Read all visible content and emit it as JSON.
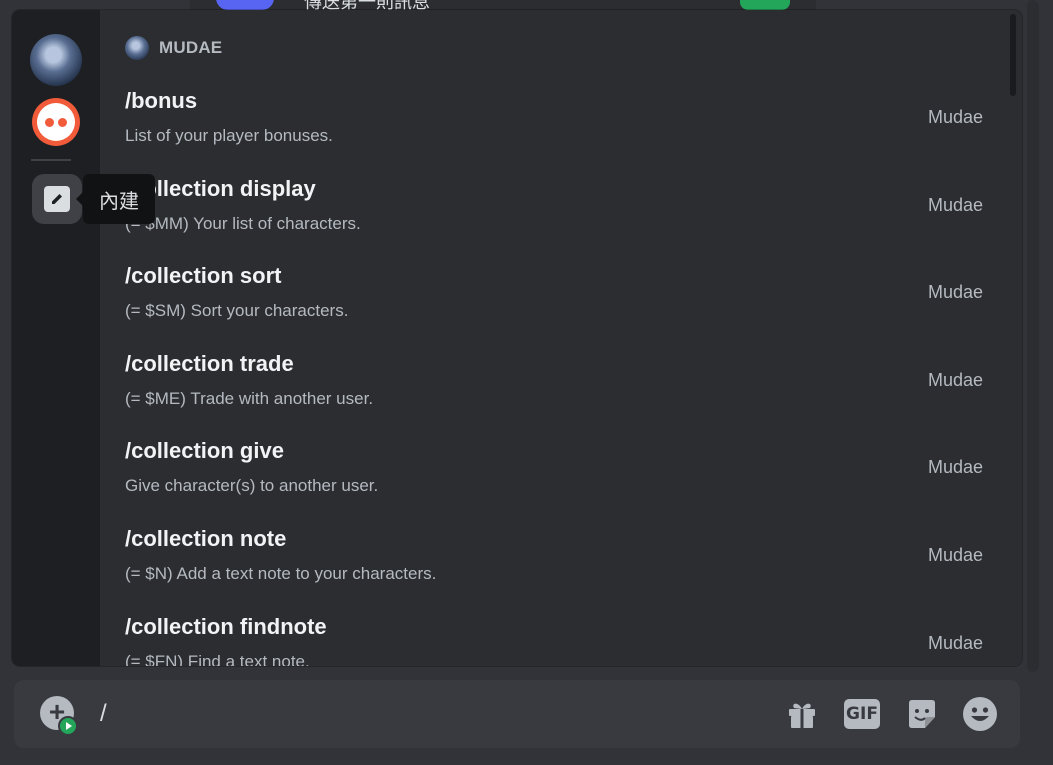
{
  "panel": {
    "section_name": "MUDAE",
    "builtin_tooltip": "內建",
    "commands": [
      {
        "name": "/bonus",
        "description": "List of your player bonuses.",
        "source": "Mudae"
      },
      {
        "name": "/collection display",
        "description": "(= $MM) Your list of characters.",
        "source": "Mudae"
      },
      {
        "name": "/collection sort",
        "description": "(= $SM) Sort your characters.",
        "source": "Mudae"
      },
      {
        "name": "/collection trade",
        "description": "(= $ME) Trade with another user.",
        "source": "Mudae"
      },
      {
        "name": "/collection give",
        "description": "Give character(s) to another user.",
        "source": "Mudae"
      },
      {
        "name": "/collection note",
        "description": "(= $N) Add a text note to your characters.",
        "source": "Mudae"
      },
      {
        "name": "/collection findnote",
        "description": "(= $FN) Find a text note.",
        "source": "Mudae"
      }
    ]
  },
  "top_peek": {
    "text": "傳送第一則訊息"
  },
  "input": {
    "value": "/",
    "icons": [
      "gift-icon",
      "gif-icon",
      "sticker-icon",
      "emoji-icon"
    ],
    "gif_label": "GIF"
  },
  "colors": {
    "background": "#313338",
    "panel": "#2b2d31",
    "rail": "#1e1f22",
    "accent_green": "#23a55a",
    "text_primary": "#f2f3f5",
    "text_secondary": "#b5bac1"
  }
}
